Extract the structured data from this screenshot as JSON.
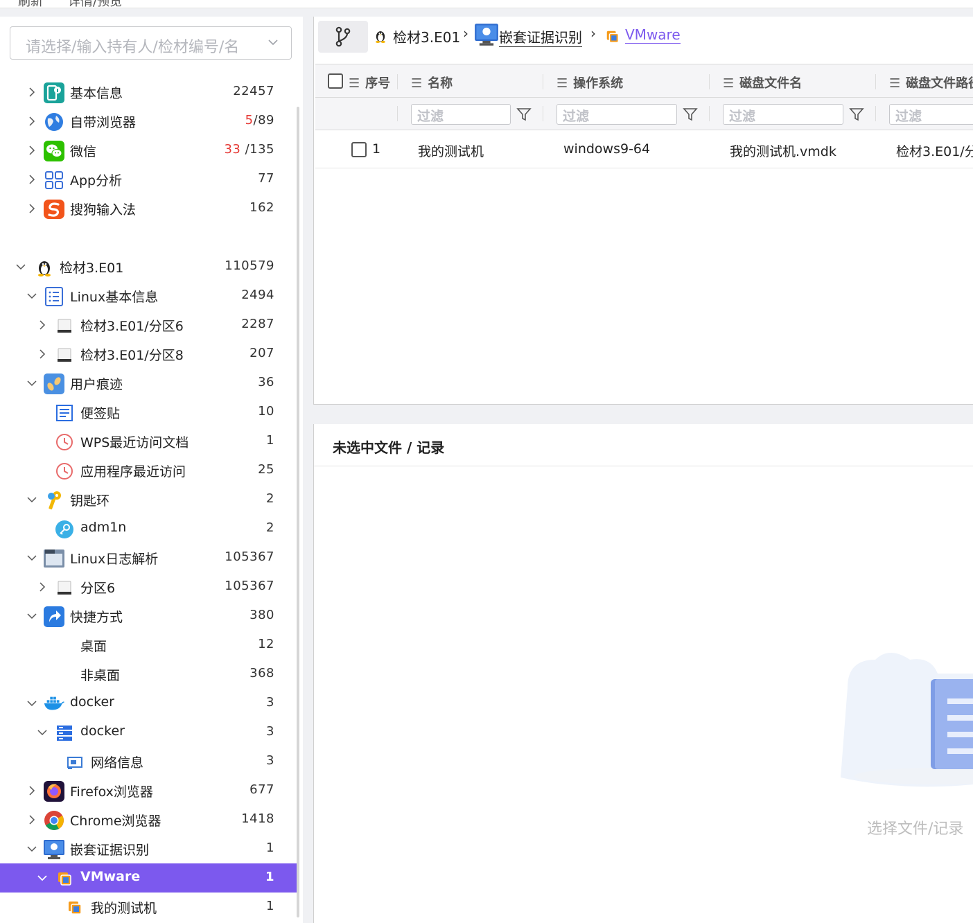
{
  "topbar": {
    "refresh_label": "刷新",
    "detail_label": "详情/预览"
  },
  "selector": {
    "placeholder": "请选择/输入持有人/检材编号/名"
  },
  "tree": [
    {
      "label": "基本信息",
      "count": "22457",
      "icon": "basic-info-icon"
    },
    {
      "label": "自带浏览器",
      "count_red": "5",
      "count_rest": "/89",
      "icon": "browser-globe-icon"
    },
    {
      "label": "微信",
      "count_red": "33",
      "count_rest": " /135",
      "icon": "wechat-icon"
    },
    {
      "label": "App分析",
      "count": "77",
      "icon": "app-grid-icon"
    },
    {
      "label": "搜狗输入法",
      "count": "162",
      "icon": "sogou-icon"
    },
    {
      "label": "检材3.E01",
      "count": "110579",
      "icon": "linux-penguin-icon"
    },
    {
      "label": "Linux基本信息",
      "count": "2494",
      "icon": "list-doc-icon"
    },
    {
      "label": "检材3.E01/分区6",
      "count": "2287",
      "icon": "disk-icon"
    },
    {
      "label": "检材3.E01/分区8",
      "count": "207",
      "icon": "disk-icon"
    },
    {
      "label": "用户痕迹",
      "count": "36",
      "icon": "footprints-icon"
    },
    {
      "label": "便签贴",
      "count": "10",
      "icon": "sticky-note-icon"
    },
    {
      "label": "WPS最近访问文档",
      "count": "1",
      "icon": "recent-clock-icon"
    },
    {
      "label": "应用程序最近访问",
      "count": "25",
      "icon": "recent-clock-icon"
    },
    {
      "label": "钥匙环",
      "count": "2",
      "icon": "keyring-icon"
    },
    {
      "label": "adm1n",
      "count": "2",
      "icon": "key-user-icon"
    },
    {
      "label": "Linux日志解析",
      "count": "105367",
      "icon": "log-icon"
    },
    {
      "label": "分区6",
      "count": "105367",
      "icon": "disk-icon"
    },
    {
      "label": "快捷方式",
      "count": "380",
      "icon": "shortcut-icon"
    },
    {
      "label": "桌面",
      "count": "12",
      "icon": ""
    },
    {
      "label": "非桌面",
      "count": "368",
      "icon": ""
    },
    {
      "label": "docker",
      "count": "3",
      "icon": "docker-icon"
    },
    {
      "label": "docker",
      "count": "3",
      "icon": "server-icon"
    },
    {
      "label": "网络信息",
      "count": "3",
      "icon": "network-card-icon"
    },
    {
      "label": "Firefox浏览器",
      "count": "677",
      "icon": "firefox-icon"
    },
    {
      "label": "Chrome浏览器",
      "count": "1418",
      "icon": "chrome-icon"
    },
    {
      "label": "嵌套证据识别",
      "count": "1",
      "icon": "nested-evidence-icon"
    },
    {
      "label": "VMware",
      "count": "1",
      "icon": "vmware-icon"
    },
    {
      "label": "我的测试机",
      "count": "1",
      "icon": "vmware-icon"
    }
  ],
  "breadcrumb": {
    "item1": "检材3.E01",
    "item2": "嵌套证据识别",
    "item3": "VMware"
  },
  "grid": {
    "columns": [
      "序号",
      "名称",
      "操作系统",
      "磁盘文件名",
      "磁盘文件路径"
    ],
    "filter_placeholder": "过滤",
    "rows": [
      {
        "index": "1",
        "name": "我的测试机",
        "os": "windows9-64",
        "disk_file": "我的测试机.vmdk",
        "disk_path": "检材3.E01/分"
      }
    ]
  },
  "detail": {
    "title": "未选中文件 / 记录",
    "empty_text": "选择文件/记录"
  },
  "colors": {
    "accent": "#7c59ee",
    "red": "#e53935"
  }
}
